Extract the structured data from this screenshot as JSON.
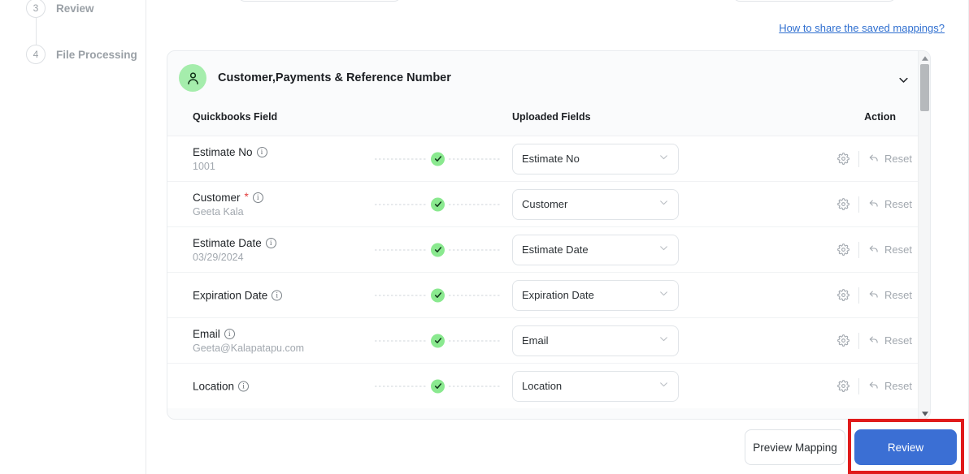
{
  "sidebar": {
    "steps": [
      {
        "number": "3",
        "label": "Review"
      },
      {
        "number": "4",
        "label": "File Processing"
      }
    ]
  },
  "share_link": {
    "label": "How to share the saved mappings?"
  },
  "card": {
    "title": "Customer,Payments & Reference Number",
    "avatar_icon": "user-icon",
    "collapse_icon": "chevron-down-icon",
    "columns": {
      "quickbooks_field": "Quickbooks Field",
      "uploaded_fields": "Uploaded Fields",
      "action": "Action"
    },
    "rows": [
      {
        "qb_label": "Estimate No",
        "required": false,
        "sample": "1001",
        "status": "mapped",
        "selected": "Estimate No",
        "settings_icon": "gear-icon",
        "reset_icon": "undo-arrow-icon",
        "reset_label": "Reset"
      },
      {
        "qb_label": "Customer",
        "required": true,
        "sample": "Geeta Kala",
        "status": "mapped",
        "selected": "Customer",
        "settings_icon": "gear-icon",
        "reset_icon": "undo-arrow-icon",
        "reset_label": "Reset"
      },
      {
        "qb_label": "Estimate Date",
        "required": false,
        "sample": "03/29/2024",
        "status": "mapped",
        "selected": "Estimate Date",
        "settings_icon": "gear-icon",
        "reset_icon": "undo-arrow-icon",
        "reset_label": "Reset"
      },
      {
        "qb_label": "Expiration Date",
        "required": false,
        "sample": "",
        "status": "mapped",
        "selected": "Expiration Date",
        "settings_icon": "gear-icon",
        "reset_icon": "undo-arrow-icon",
        "reset_label": "Reset"
      },
      {
        "qb_label": "Email",
        "required": false,
        "sample": "Geeta@Kalapatapu.com",
        "status": "mapped",
        "selected": "Email",
        "settings_icon": "gear-icon",
        "reset_icon": "undo-arrow-icon",
        "reset_label": "Reset"
      },
      {
        "qb_label": "Location",
        "required": false,
        "sample": "",
        "status": "mapped",
        "selected": "Location",
        "settings_icon": "gear-icon",
        "reset_icon": "undo-arrow-icon",
        "reset_label": "Reset"
      }
    ]
  },
  "footer": {
    "preview_label": "Preview Mapping",
    "review_label": "Review"
  },
  "colors": {
    "primary_button": "#3b6fd4",
    "link": "#2f6fd0",
    "check_badge": "#8ae98f",
    "avatar": "#a5edac",
    "required_star": "#e23b3b",
    "annotation": "#e01b1b"
  }
}
